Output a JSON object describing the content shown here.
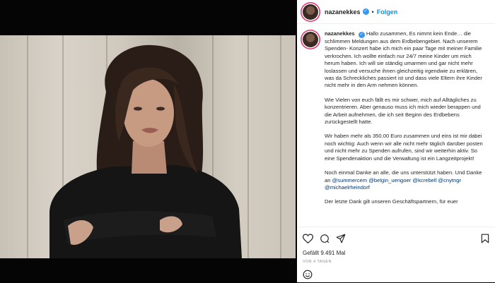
{
  "post": {
    "username": "nazanekkes",
    "follow_label": "Folgen",
    "separator": "•",
    "verified_mark": "✓",
    "likes": "Gefällt 9.491 Mal",
    "age": "VOR 4 TAGEN"
  },
  "caption": {
    "username": "nazanekkes",
    "paragraph_1": "Hallo zusammen, Es nimmt kein Ende… die schlimmen Meldungen aus dem Erdbebengebiet. Nach unserem Spenden- Konzert habe ich mich ein paar Tage mit meiner Familie verkrochen. Ich wollte einfach nur 24/7 meine Kinder um mich herum haben. Ich will sie ständig umarmen und gar nicht mehr loslassen und versuche ihnen gleichzeitig irgendwie zu erklären, was da Schreckliches passiert ist und dass viele Eltern ihre Kinder nicht mehr in den Arm nehmen können.",
    "paragraph_2": "Wie Vielen von euch fällt es mir schwer, mich auf Alltägliches zu konzentrieren. Aber genauso muss ich mich wieder berappen und die Arbeit aufnehmen, die ich seit Beginn des Erdbebens zurückgestellt hatte.",
    "paragraph_3": "Wir haben mehr als 350.00 Euro zusammen und eins ist mir dabei noch wichtig: Auch wenn wir alle nicht mehr täglich darüber posten und nicht mehr zu Spenden aufrufen, sind wir weiterhin aktiv. So eine Spendenaktion und die Verwaltung ist ein Langzeitprojekt!",
    "paragraph_4_text": "Noch einmal Danke an alle, die uns unterstützt haben. Und Danke an",
    "mentions": [
      "@summercem",
      "@belgin_uengoer",
      "@kcrebell",
      "@cnytngr",
      "@michaelrheindorf"
    ],
    "paragraph_5": "Der letzte Dank gilt unseren Geschäftspartnern, für euer"
  },
  "icons": {
    "like": "heart-icon",
    "comment": "comment-icon",
    "share": "share-icon",
    "save": "bookmark-icon",
    "emoji": "smiley-icon"
  },
  "colors": {
    "verified": "#3897f0",
    "follow": "#0095f6",
    "mention": "#00376b",
    "story_ring": "#e1306c"
  }
}
